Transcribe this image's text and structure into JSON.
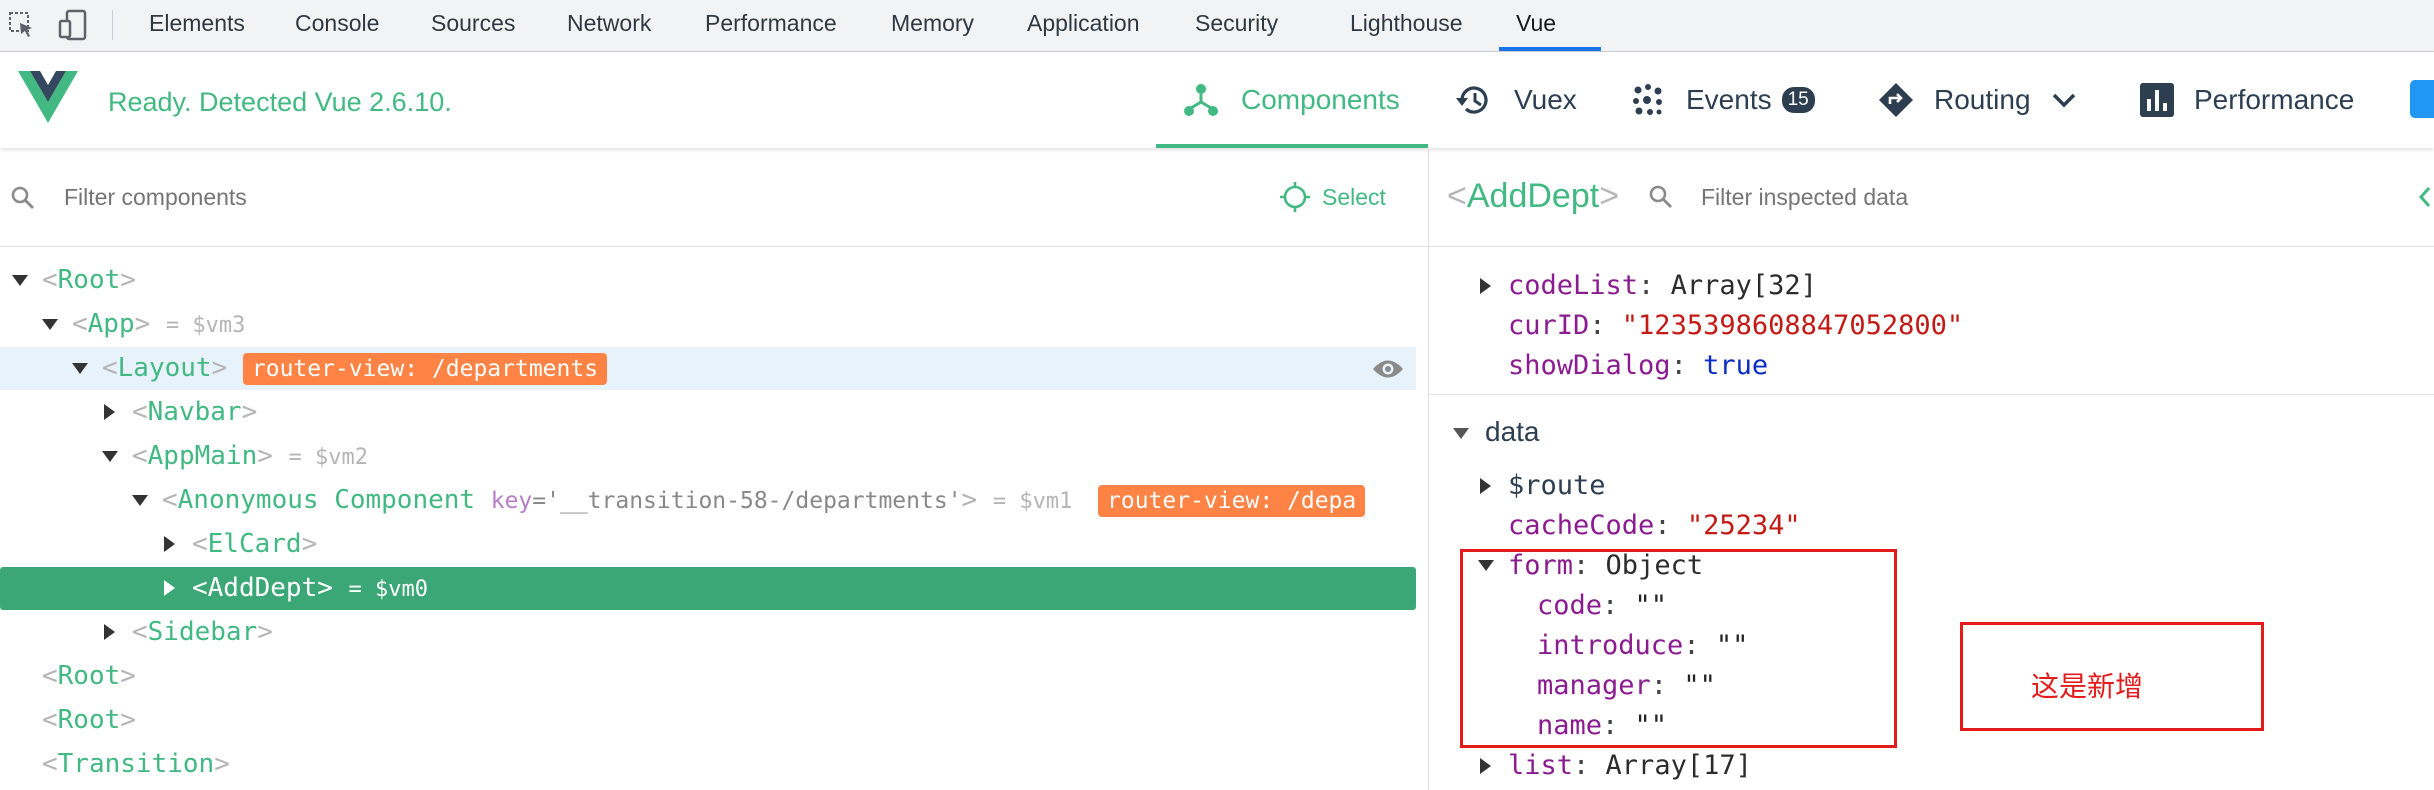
{
  "devtools": {
    "tabs": [
      "Elements",
      "Console",
      "Sources",
      "Network",
      "Performance",
      "Memory",
      "Application",
      "Security",
      "Lighthouse",
      "Vue"
    ],
    "active_tab": "Vue"
  },
  "vue_header": {
    "status": "Ready. Detected Vue 2.6.10.",
    "nav": {
      "components": "Components",
      "vuex": "Vuex",
      "events": "Events",
      "events_count": "15",
      "routing": "Routing",
      "performance": "Performance"
    },
    "active_nav": "Components"
  },
  "colors": {
    "vue_green": "#42b983",
    "selected_row": "#3ba776",
    "router_tag": "#ff8344",
    "annotation_red": "#e31b1b"
  },
  "left": {
    "filter_placeholder": "Filter components",
    "select_label": "Select",
    "tree": {
      "root1": "Root",
      "app": "App",
      "app_vm": "= $vm3",
      "layout": "Layout",
      "layout_tag": "router-view: /departments",
      "navbar": "Navbar",
      "appmain": "AppMain",
      "appmain_vm": "= $vm2",
      "anon": "Anonymous Component",
      "anon_key_name": "key",
      "anon_key_value": "='__transition-58-/departments'",
      "anon_vm": "= $vm1",
      "anon_tag": "router-view: /depa",
      "elcard": "ElCard",
      "adddept": "AddDept",
      "adddept_vm": "= $vm0",
      "sidebar": "Sidebar",
      "root2": "Root",
      "root3": "Root",
      "transition": "Transition"
    }
  },
  "right": {
    "component_name": "AddDept",
    "filter_placeholder": "Filter inspected data",
    "props": {
      "codeList_key": "codeList",
      "codeList_val": "Array[32]",
      "curID_key": "curID",
      "curID_val": "\"1235398608847052800\"",
      "showDialog_key": "showDialog",
      "showDialog_val": "true"
    },
    "data_section": "data",
    "data": {
      "route_key": "$route",
      "cacheCode_key": "cacheCode",
      "cacheCode_val": "\"25234\"",
      "form_key": "form",
      "form_val": "Object",
      "code_key": "code",
      "code_val": "\"\"",
      "introduce_key": "introduce",
      "introduce_val": "\"\"",
      "manager_key": "manager",
      "manager_val": "\"\"",
      "name_key": "name",
      "name_val": "\"\"",
      "list_key": "list",
      "list_val": "Array[17]"
    },
    "annotation": "这是新增"
  }
}
